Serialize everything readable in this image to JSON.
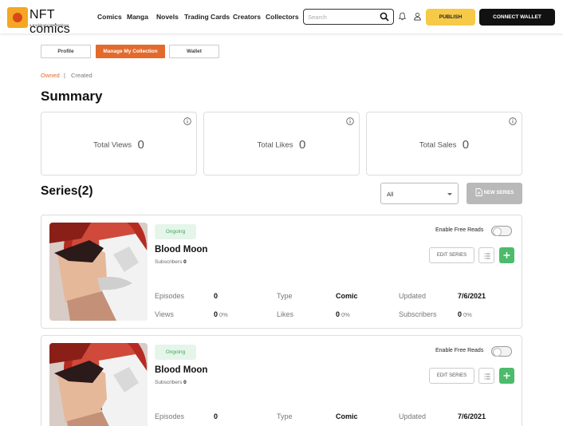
{
  "header": {
    "logo_text": "NFT comics",
    "logo_sub": "a Kodokomi Marketplace",
    "nav": [
      "Comics",
      "Manga",
      "Novels",
      "Trading Cards",
      "Creators",
      "Collectors"
    ],
    "search_placeholder": "Search",
    "publish_label": "PUBLISH",
    "connect_label": "CONNECT WALLET"
  },
  "tabs": [
    {
      "label": "Profile",
      "active": false
    },
    {
      "label": "Manage My Collection",
      "active": true
    },
    {
      "label": "Wallet",
      "active": false
    }
  ],
  "filter_tabs": {
    "owned": "Owned",
    "separator": "|",
    "created": "Created"
  },
  "summary": {
    "title": "Summary",
    "stats": [
      {
        "label": "Total Views",
        "value": "0"
      },
      {
        "label": "Total Likes",
        "value": "0"
      },
      {
        "label": "Total Sales",
        "value": "0"
      }
    ]
  },
  "series_section": {
    "title": "Series(2)",
    "filter_value": "All",
    "new_series_label": "NEW SERIES"
  },
  "series": [
    {
      "status": "Ongoing",
      "title": "Blood Moon",
      "subscribers_label": "Subscribers",
      "subscribers": "0",
      "free_reads_label": "Enable Free Reads",
      "edit_label": "EDIT SERIES",
      "episodes_label": "Episodes",
      "episodes": "0",
      "type_label": "Type",
      "type": "Comic",
      "updated_label": "Updated",
      "updated": "7/6/2021",
      "views_label": "Views",
      "views": "0",
      "views_pct": "0%",
      "likes_label": "Likes",
      "likes": "0",
      "likes_pct": "0%",
      "subs_label": "Subscribers",
      "subs": "0",
      "subs_pct": "0%"
    },
    {
      "status": "Ongoing",
      "title": "Blood Moon",
      "subscribers_label": "Subscribers",
      "subscribers": "0",
      "free_reads_label": "Enable Free Reads",
      "edit_label": "EDIT SERIES",
      "episodes_label": "Episodes",
      "episodes": "0",
      "type_label": "Type",
      "type": "Comic",
      "updated_label": "Updated",
      "updated": "7/6/2021"
    }
  ],
  "colors": {
    "accent_orange": "#e36a2d",
    "publish_yellow": "#f7c948",
    "add_green": "#4cbb6c",
    "ongoing_green": "#3eaa5c"
  }
}
